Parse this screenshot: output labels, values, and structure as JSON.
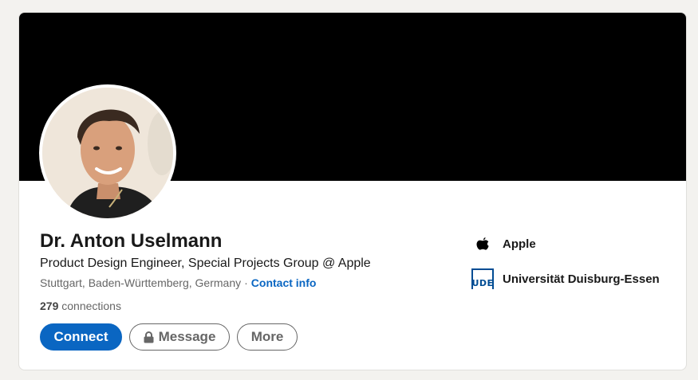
{
  "profile": {
    "name": "Dr. Anton Uselmann",
    "headline": "Product Design Engineer, Special Projects Group @ Apple",
    "location": "Stuttgart, Baden-Württemberg, Germany",
    "separator": "·",
    "contact_info_label": "Contact info",
    "connections_count": "279",
    "connections_label": "connections"
  },
  "actions": {
    "connect_label": "Connect",
    "message_label": "Message",
    "more_label": "More"
  },
  "sidebar": {
    "items": [
      {
        "label": "Apple",
        "icon": "apple-logo-icon"
      },
      {
        "label": "Universität Duisburg-Essen",
        "icon": "ude-logo-icon",
        "logo_text": "UDE"
      }
    ]
  },
  "colors": {
    "brand_blue": "#0a66c2",
    "cover": "#000000",
    "ude_blue": "#004c93"
  }
}
